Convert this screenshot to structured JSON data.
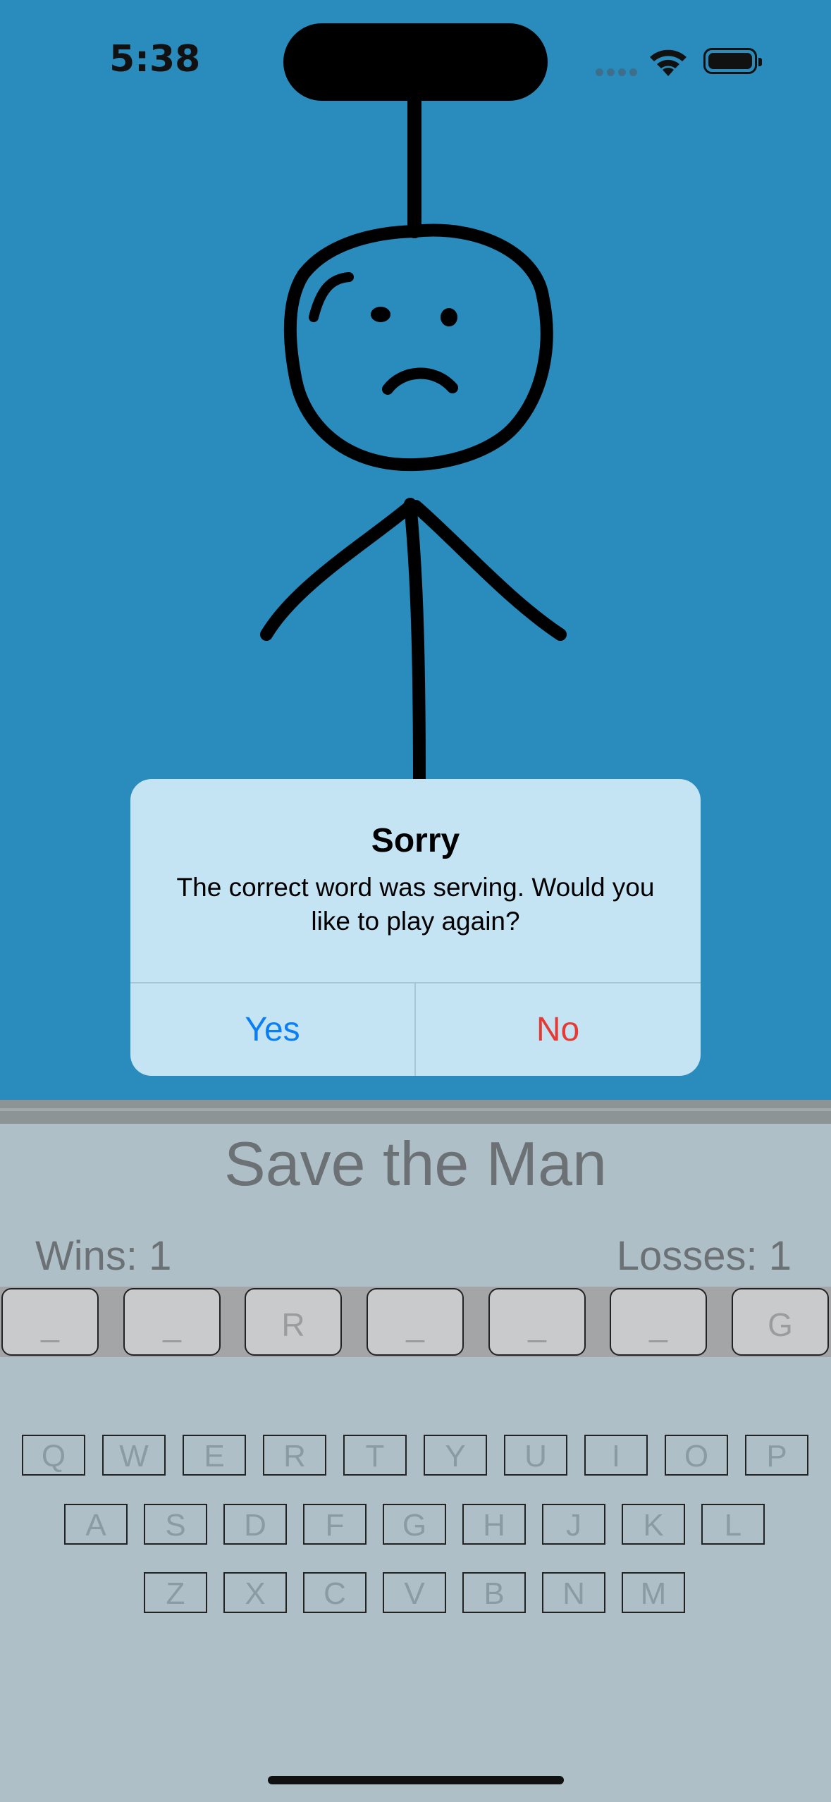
{
  "status": {
    "time": "5:38"
  },
  "alert": {
    "title": "Sorry",
    "message": "The correct word was serving. Would you like to play again?",
    "yes_label": "Yes",
    "no_label": "No"
  },
  "game": {
    "title": "Save the Man",
    "wins": "Wins: 1",
    "losses": "Losses: 1",
    "word_slots": [
      "_",
      "_",
      "R",
      "_",
      "_",
      "_",
      "G"
    ]
  },
  "keyboard": {
    "row1": [
      "Q",
      "W",
      "E",
      "R",
      "T",
      "Y",
      "U",
      "I",
      "O",
      "P"
    ],
    "row2": [
      "A",
      "S",
      "D",
      "F",
      "G",
      "H",
      "J",
      "K",
      "L"
    ],
    "row3": [
      "Z",
      "X",
      "C",
      "V",
      "B",
      "N",
      "M"
    ]
  },
  "colors": {
    "sky": "#2a8bbd",
    "panel": "#aebfc8",
    "alert_bg": "#c4e4f4",
    "yes_blue": "#0a7ff5",
    "no_red": "#e63b35"
  }
}
